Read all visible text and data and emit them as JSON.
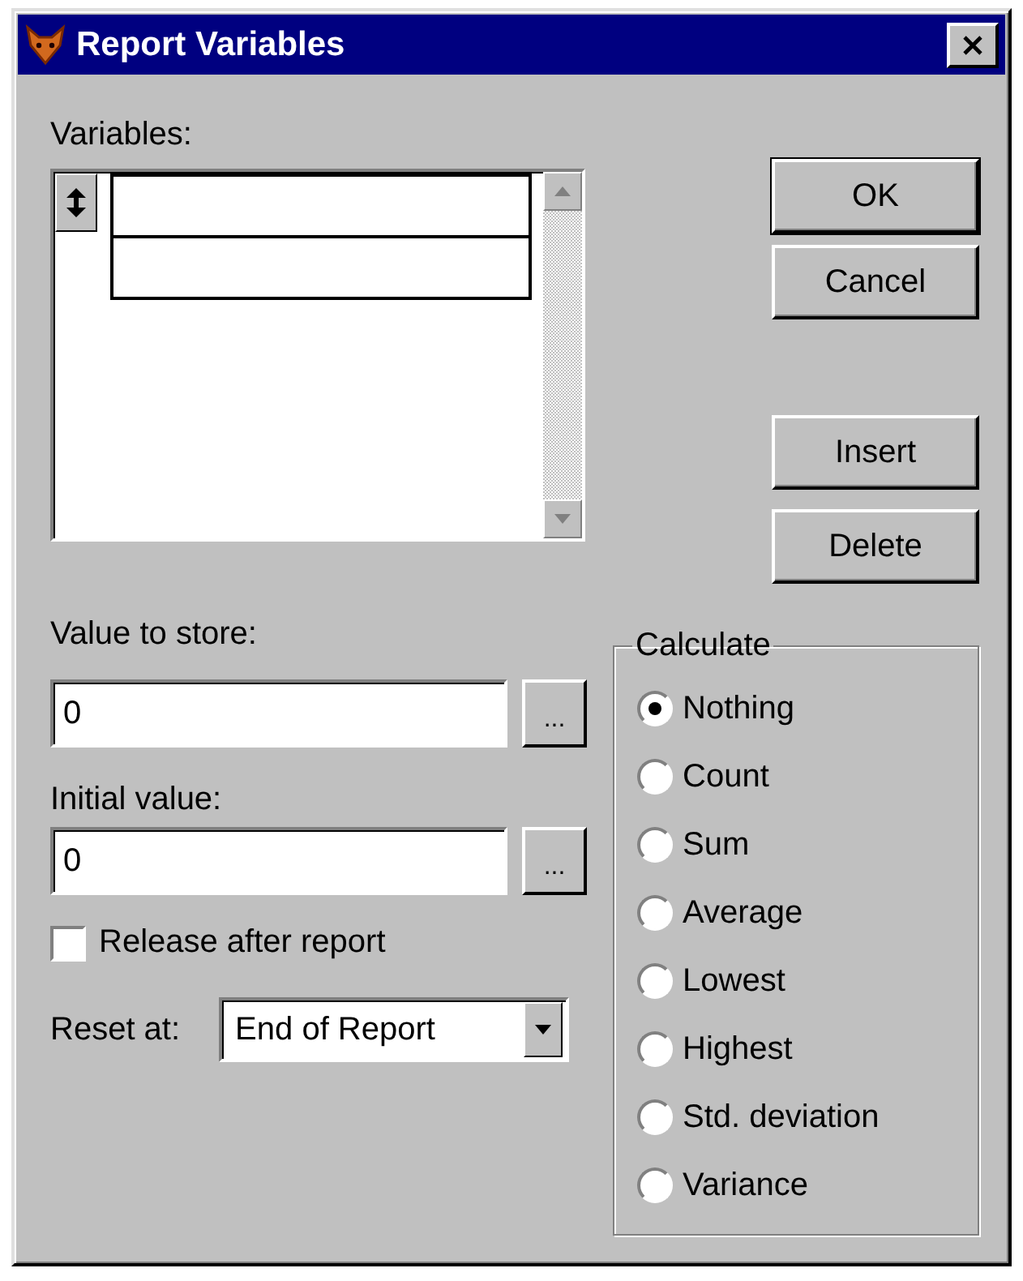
{
  "window": {
    "title": "Report Variables"
  },
  "variables": {
    "label": "Variables:"
  },
  "buttons": [
    {
      "label": "OK",
      "kind": "default"
    },
    {
      "label": "Cancel",
      "kind": "normal"
    },
    {
      "label": "Insert",
      "kind": "spaced"
    },
    {
      "label": "Delete",
      "kind": "normal"
    }
  ],
  "value_to_store": {
    "label": "Value to store:",
    "value": "0",
    "browse": "..."
  },
  "initial_value": {
    "label": "Initial value:",
    "value": "0",
    "browse": "..."
  },
  "release_after_report": {
    "label": "Release after report",
    "checked": false
  },
  "reset_at": {
    "label": "Reset at:",
    "value": "End of Report"
  },
  "calculate": {
    "title": "Calculate",
    "options": [
      {
        "label": "Nothing",
        "selected": true
      },
      {
        "label": "Count",
        "selected": false
      },
      {
        "label": "Sum",
        "selected": false
      },
      {
        "label": "Average",
        "selected": false
      },
      {
        "label": "Lowest",
        "selected": false
      },
      {
        "label": "Highest",
        "selected": false
      },
      {
        "label": "Std. deviation",
        "selected": false
      },
      {
        "label": "Variance",
        "selected": false
      }
    ]
  }
}
